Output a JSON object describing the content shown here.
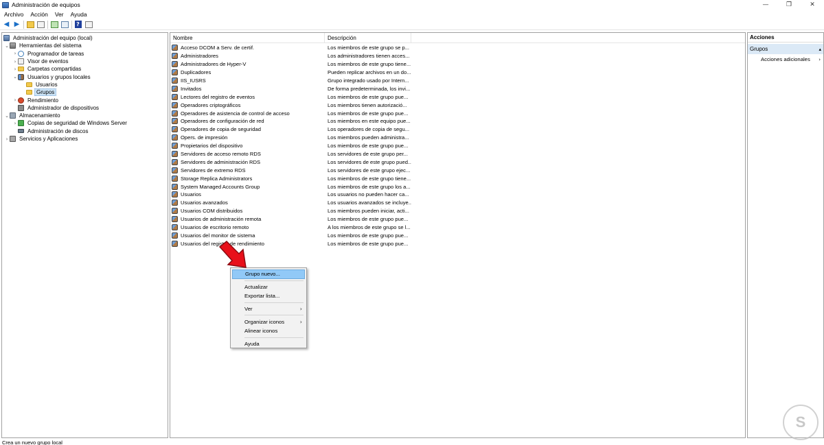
{
  "window": {
    "title": "Administración de equipos",
    "controls": [
      "—",
      "❐",
      "✕"
    ]
  },
  "menu": [
    "Archivo",
    "Acción",
    "Ver",
    "Ayuda"
  ],
  "toolbar": [
    "back-icon",
    "forward-icon",
    "up-folder-icon",
    "show-hide-tree-icon",
    "refresh-icon",
    "export-list-icon",
    "help-icon",
    "properties-icon"
  ],
  "tree": {
    "root": "Administración del equipo (local)",
    "items": [
      {
        "label": "Herramientas del sistema",
        "level": 1,
        "expander": "⌄"
      },
      {
        "label": "Programador de tareas",
        "level": 2,
        "expander": "›"
      },
      {
        "label": "Visor de eventos",
        "level": 2,
        "expander": "›"
      },
      {
        "label": "Carpetas compartidas",
        "level": 2,
        "expander": "›"
      },
      {
        "label": "Usuarios y grupos locales",
        "level": 2,
        "expander": "⌄"
      },
      {
        "label": "Usuarios",
        "level": 3,
        "expander": ""
      },
      {
        "label": "Grupos",
        "level": 3,
        "expander": "",
        "selected": true
      },
      {
        "label": "Rendimiento",
        "level": 2,
        "expander": "›"
      },
      {
        "label": "Administrador de dispositivos",
        "level": 2,
        "expander": ""
      },
      {
        "label": "Almacenamiento",
        "level": 1,
        "expander": "⌄"
      },
      {
        "label": "Copias de seguridad de Windows Server",
        "level": 2,
        "expander": "›"
      },
      {
        "label": "Administración de discos",
        "level": 2,
        "expander": ""
      },
      {
        "label": "Servicios y Aplicaciones",
        "level": 1,
        "expander": "›"
      }
    ]
  },
  "list": {
    "columns": [
      "Nombre",
      "Descripción"
    ],
    "rows": [
      {
        "name": "Acceso DCOM a Serv. de certif.",
        "desc": "Los miembros de este grupo se p..."
      },
      {
        "name": "Administradores",
        "desc": "Los administradores tienen acces..."
      },
      {
        "name": "Administradores de Hyper-V",
        "desc": "Los miembros de este grupo tiene..."
      },
      {
        "name": "Duplicadores",
        "desc": "Pueden replicar archivos en un do..."
      },
      {
        "name": "IIS_IUSRS",
        "desc": "Grupo integrado usado por Intern..."
      },
      {
        "name": "Invitados",
        "desc": "De forma predeterminada, los invi..."
      },
      {
        "name": "Lectores del registro de eventos",
        "desc": "Los miembros de este grupo pue..."
      },
      {
        "name": "Operadores criptográficos",
        "desc": "Los miembros tienen autorizació..."
      },
      {
        "name": "Operadores de asistencia de control de acceso",
        "desc": "Los miembros de este grupo pue..."
      },
      {
        "name": "Operadores de configuración de red",
        "desc": "Los miembros en este equipo pue..."
      },
      {
        "name": "Operadores de copia de seguridad",
        "desc": "Los operadores de copia de segu..."
      },
      {
        "name": "Opers. de impresión",
        "desc": "Los miembros pueden administra..."
      },
      {
        "name": "Propietarios del dispositivo",
        "desc": "Los miembros de este grupo pue..."
      },
      {
        "name": "Servidores de acceso remoto RDS",
        "desc": "Los servidores de este grupo per..."
      },
      {
        "name": "Servidores de administración RDS",
        "desc": "Los servidores de este grupo pued..."
      },
      {
        "name": "Servidores de extremo RDS",
        "desc": "Los servidores de este grupo ejec..."
      },
      {
        "name": "Storage Replica Administrators",
        "desc": "Los miembros de este grupo tiene..."
      },
      {
        "name": "System Managed Accounts Group",
        "desc": "Los miembros de este grupo los a..."
      },
      {
        "name": "Usuarios",
        "desc": "Los usuarios no pueden hacer ca..."
      },
      {
        "name": "Usuarios avanzados",
        "desc": "Los usuarios avanzados se incluye..."
      },
      {
        "name": "Usuarios COM distribuidos",
        "desc": "Los miembros pueden iniciar, acti..."
      },
      {
        "name": "Usuarios de administración remota",
        "desc": "Los miembros de este grupo pue..."
      },
      {
        "name": "Usuarios de escritorio remoto",
        "desc": "A los miembros de este grupo se l..."
      },
      {
        "name": "Usuarios del monitor de sistema",
        "desc": "Los miembros de este grupo pue..."
      },
      {
        "name": "Usuarios del registro de rendimiento",
        "desc": "Los miembros de este grupo pue..."
      }
    ]
  },
  "context_menu": {
    "items": [
      {
        "label": "Grupo nuevo...",
        "highlighted": true
      },
      {
        "separator": true
      },
      {
        "label": "Actualizar"
      },
      {
        "label": "Exportar lista..."
      },
      {
        "separator": true
      },
      {
        "label": "Ver",
        "submenu": true
      },
      {
        "separator": true
      },
      {
        "label": "Organizar iconos",
        "submenu": true
      },
      {
        "label": "Alinear iconos"
      },
      {
        "separator": true
      },
      {
        "label": "Ayuda"
      }
    ]
  },
  "actions": {
    "header": "Acciones",
    "section": "Grupos",
    "section_chevron": "▴",
    "items": [
      {
        "label": "Acciones adicionales",
        "chevron": "›"
      }
    ]
  },
  "status": "Crea un nuevo grupo local",
  "watermark": "S",
  "colors": {
    "selection": "#cce4f7",
    "menu_highlight": "#91c9f7",
    "actions_section": "#dbe9f6",
    "pointer_arrow": "#e8101a"
  }
}
